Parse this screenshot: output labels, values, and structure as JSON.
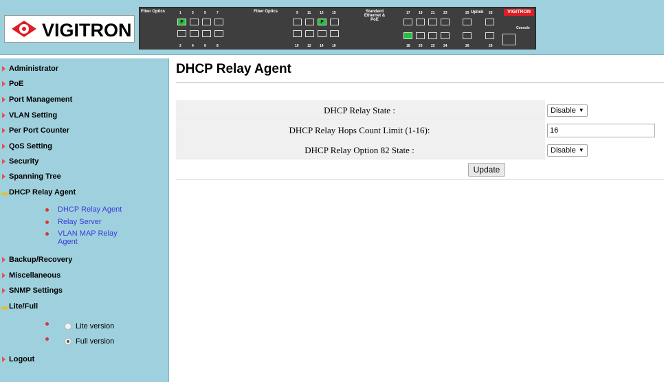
{
  "header": {
    "logo_text": "VIGITRON",
    "panel": {
      "group1_label": "Fiber Optics",
      "group2_label": "Fiber Optics",
      "group3_label": "Standard Ethernet & PoE",
      "uplink_label": "Uplink",
      "brand": "VIGITRON",
      "console_label": "Console",
      "top_numbers_g1": [
        "1",
        "3",
        "5",
        "7"
      ],
      "bottom_numbers_g1": [
        "2",
        "4",
        "6",
        "8"
      ],
      "top_numbers_g2": [
        "9",
        "11",
        "13",
        "15"
      ],
      "bottom_numbers_g2": [
        "10",
        "12",
        "14",
        "16"
      ],
      "top_numbers_g3": [
        "17",
        "19",
        "21",
        "23"
      ],
      "bottom_numbers_g3": [
        "18",
        "20",
        "22",
        "24"
      ],
      "uplink_top": [
        "25",
        "25"
      ],
      "uplink_bottom": [
        "26",
        "26"
      ],
      "fiber_marker": "F"
    }
  },
  "sidebar": {
    "items": [
      {
        "label": "Administrator"
      },
      {
        "label": "PoE"
      },
      {
        "label": "Port Management"
      },
      {
        "label": "VLAN Setting"
      },
      {
        "label": "Per Port Counter"
      },
      {
        "label": "QoS Setting"
      },
      {
        "label": "Security"
      },
      {
        "label": "Spanning Tree"
      },
      {
        "label": "DHCP Relay Agent"
      },
      {
        "label": "Backup/Recovery"
      },
      {
        "label": "Miscellaneous"
      },
      {
        "label": "SNMP Settings"
      },
      {
        "label": "Lite/Full"
      },
      {
        "label": "Logout"
      }
    ],
    "dhcp_sub": [
      {
        "label": "DHCP Relay Agent"
      },
      {
        "label": "Relay Server"
      },
      {
        "label": "VLAN MAP Relay Agent"
      }
    ],
    "lite_full": [
      {
        "label": "Lite version",
        "selected": false
      },
      {
        "label": "Full version",
        "selected": true
      }
    ]
  },
  "main": {
    "title": "DHCP Relay Agent",
    "rows": [
      {
        "label": "DHCP Relay State :",
        "value": "Disable"
      },
      {
        "label": "DHCP Relay Hops Count Limit (1-16):",
        "value": "16"
      },
      {
        "label": "DHCP Relay Option 82 State :",
        "value": "Disable"
      }
    ],
    "update_label": "Update",
    "select_caret": "▼"
  },
  "colors": {
    "sidebar_bg": "#9fd0dd",
    "brand_red": "#e01c24",
    "port_lit": "#24c13a",
    "link_blue": "#3a3ae0"
  }
}
